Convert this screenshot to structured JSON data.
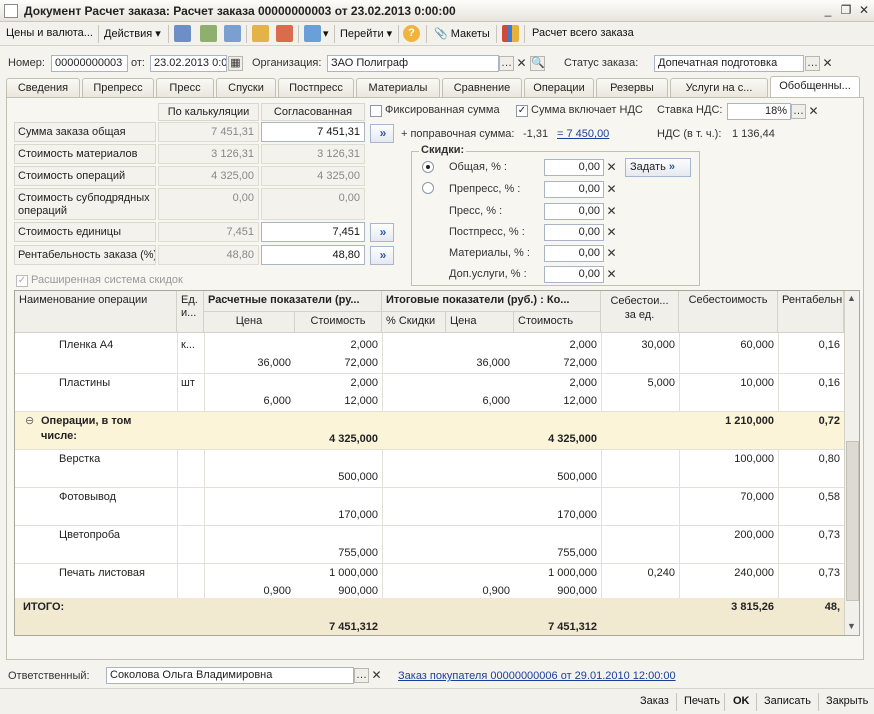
{
  "window": {
    "title": "Документ Расчет заказа: Расчет заказа 00000000003 от 23.02.2013 0:00:00"
  },
  "toolbar": {
    "prices_label": "Цены и валюта...",
    "actions_label": "Действия",
    "goto_label": "Перейти",
    "help_label": "?",
    "layouts_label": "Макеты",
    "calc_all_label": "Расчет всего заказа"
  },
  "header": {
    "number_label": "Номер:",
    "number_value": "00000000003",
    "date_label": "от:",
    "date_value": "23.02.2013 0:00",
    "org_label": "Организация:",
    "org_value": "ЗАО Полиграф",
    "status_label": "Статус заказа:",
    "status_value": "Допечатная подготовка"
  },
  "tabs": [
    "Сведения",
    "Препресс",
    "Пресс",
    "Спуски",
    "Постпресс",
    "Материалы",
    "Сравнение",
    "Операции",
    "Резервы",
    "Услуги на с...",
    "Обобщенны..."
  ],
  "summary": {
    "col_calc": "По калькуляции",
    "col_agreed": "Согласованная",
    "rows": [
      {
        "label": "Сумма заказа общая",
        "calc": "7 451,31",
        "agreed": "7 451,31"
      },
      {
        "label": "Стоимость материалов",
        "calc": "3 126,31",
        "agreed": "3 126,31"
      },
      {
        "label": "Стоимость операций",
        "calc": "4 325,00",
        "agreed": "4 325,00"
      },
      {
        "label": "Стоимость субподрядных операций",
        "calc": "0,00",
        "agreed": "0,00"
      },
      {
        "label": "Стоимость единицы",
        "calc": "7,451",
        "agreed": "7,451"
      },
      {
        "label": "Рентабельность заказа (%)",
        "calc": "48,80",
        "agreed": "48,80"
      }
    ]
  },
  "options": {
    "fixed_sum_label": "Фиксированная сумма",
    "incl_vat_label": "Сумма включает НДС",
    "vat_rate_label": "Ставка НДС:",
    "vat_rate_value": "18%",
    "correction_label": "+ поправочная сумма:",
    "correction_value": "-1,31",
    "correction_result": "= 7 450,00",
    "vat_amount_label": "НДС (в т. ч.):",
    "vat_amount_value": "1 136,44",
    "extended_discount_label": "Расширенная система скидок"
  },
  "discounts": {
    "title": "Скидки:",
    "set_label": "Задать",
    "rows": [
      {
        "label": "Общая, % :",
        "value": "0,00"
      },
      {
        "label": "Препресс, % :",
        "value": "0,00"
      },
      {
        "label": "Пресс, % :",
        "value": "0,00"
      },
      {
        "label": "Постпресс, % :",
        "value": "0,00"
      },
      {
        "label": "Материалы, % :",
        "value": "0,00"
      },
      {
        "label": "Доп.услуги, % :",
        "value": "0,00"
      }
    ]
  },
  "grid": {
    "headers": {
      "name": "Наименование операции",
      "unit": "Ед. и...",
      "calc_group": "Расчетные показатели (ру...",
      "final_group": "Итоговые показатели (руб.) : Ко...",
      "cost_unit": "Себестои... за ед.",
      "cost": "Себестоимость",
      "profit": "Рентабельн...",
      "price": "Цена",
      "amount": "Стоимость",
      "disc": "% Скидки",
      "price2": "Цена",
      "amount2": "Стоимость"
    },
    "rows": [
      {
        "name": "Пленка А4",
        "unit": "к...",
        "qty1": "2,000",
        "price1": "36,000",
        "amt1": "72,000",
        "qty2": "2,000",
        "price2": "36,000",
        "amt2": "72,000",
        "costu": "30,000",
        "cost": "60,000",
        "prof": "0,16"
      },
      {
        "name": "Пластины",
        "unit": "шт",
        "qty1": "2,000",
        "price1": "6,000",
        "amt1": "12,000",
        "qty2": "2,000",
        "price2": "6,000",
        "amt2": "12,000",
        "costu": "5,000",
        "cost": "10,000",
        "prof": "0,16"
      },
      {
        "name": "Верстка",
        "unit": "",
        "qty1": "",
        "price1": "",
        "amt1": "500,000",
        "qty2": "",
        "price2": "",
        "amt2": "500,000",
        "costu": "",
        "cost": "100,000",
        "prof": "0,80"
      },
      {
        "name": "Фотовывод",
        "unit": "",
        "qty1": "",
        "price1": "",
        "amt1": "170,000",
        "qty2": "",
        "price2": "",
        "amt2": "170,000",
        "costu": "",
        "cost": "70,000",
        "prof": "0,58"
      },
      {
        "name": "Цветопроба",
        "unit": "",
        "qty1": "",
        "price1": "",
        "amt1": "755,000",
        "qty2": "",
        "price2": "",
        "amt2": "755,000",
        "costu": "",
        "cost": "200,000",
        "prof": "0,73"
      },
      {
        "name": "Печать листовая",
        "unit": "",
        "qty1": "1 000,000",
        "price1": "0,900",
        "amt1": "900,000",
        "qty2": "1 000,000",
        "price2": "0,900",
        "amt2": "900,000",
        "costu": "0,240",
        "cost": "240,000",
        "prof": "0,73"
      }
    ],
    "group_row": {
      "name1": "Операции, в том",
      "name2": "числе:",
      "amt1": "4 325,000",
      "amt2": "4 325,000",
      "cost": "1 210,000",
      "prof": "0,72"
    },
    "total_row": {
      "name": "ИТОГО:",
      "amt1": "7 451,312",
      "amt2": "7 451,312",
      "cost": "3 815,26",
      "prof": "48,"
    }
  },
  "footer": {
    "responsible_label": "Ответственный:",
    "responsible_value": "Соколова Ольга Владимировна",
    "order_link": "Заказ покупателя 00000000006 от 29.01.2010 12:00:00"
  },
  "bottom": {
    "order": "Заказ",
    "print": "Печать",
    "ok": "OK",
    "save": "Записать",
    "close": "Закрыть"
  },
  "colors": {
    "accent": "#2a5aa6",
    "group_row": "#fbf4d9",
    "link": "#1a3f9a"
  }
}
